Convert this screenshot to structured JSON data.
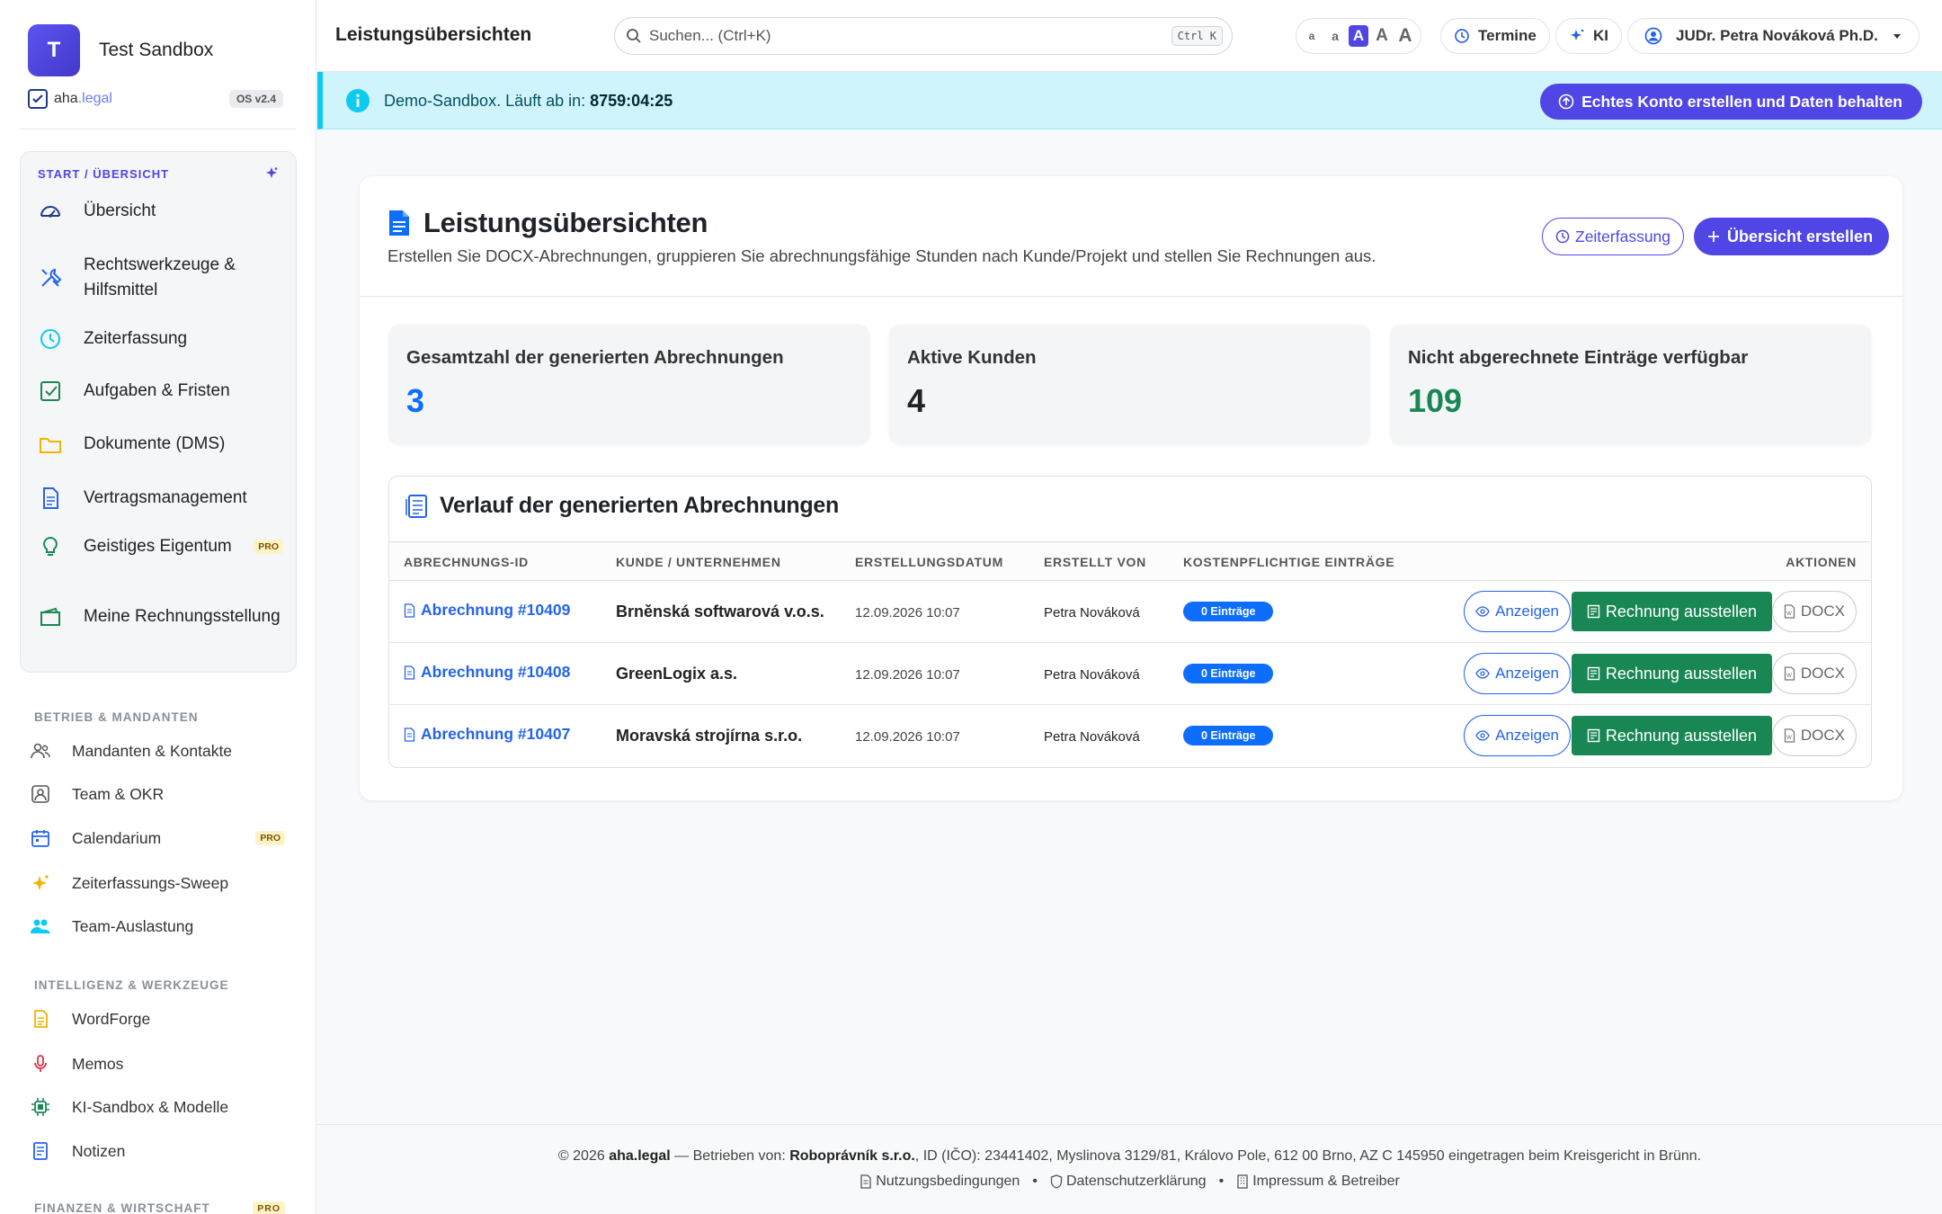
{
  "sidebar": {
    "avatar_letter": "T",
    "workspace_name": "Test Sandbox",
    "logo_brand": "aha",
    "logo_domain": ".legal",
    "os_version": "OS v2.4",
    "start_title": "START / ÜBERSICHT",
    "start_items": [
      {
        "label": "Übersicht",
        "icon": "gauge-icon"
      },
      {
        "label": "Rechtswerkzeuge & Hilfsmittel",
        "icon": "tools-icon"
      },
      {
        "label": "Zeiterfassung",
        "icon": "clock-icon"
      },
      {
        "label": "Aufgaben & Fristen",
        "icon": "check-square-icon"
      },
      {
        "label": "Dokumente (DMS)",
        "icon": "folder-icon"
      },
      {
        "label": "Vertragsmanagement",
        "icon": "document-icon"
      },
      {
        "label": "Geistiges Eigentum",
        "icon": "lightbulb-icon",
        "badge": "PRO"
      },
      {
        "label": "Meine Rechnungsstellung",
        "icon": "wallet-icon"
      }
    ],
    "section_betrieb": "BETRIEB & MANDANTEN",
    "betrieb_items": [
      {
        "label": "Mandanten & Kontakte",
        "icon": "people-icon"
      },
      {
        "label": "Team & OKR",
        "icon": "person-badge-icon"
      },
      {
        "label": "Calendarium",
        "icon": "calendar-icon",
        "badge": "PRO"
      },
      {
        "label": "Zeiterfassungs-Sweep",
        "icon": "sparkle-icon"
      },
      {
        "label": "Team-Auslastung",
        "icon": "team-icon"
      }
    ],
    "section_intelligenz": "INTELLIGENZ & WERKZEUGE",
    "intelligenz_items": [
      {
        "label": "WordForge",
        "icon": "file-word-icon"
      },
      {
        "label": "Memos",
        "icon": "microphone-icon"
      },
      {
        "label": "KI-Sandbox & Modelle",
        "icon": "cpu-icon"
      },
      {
        "label": "Notizen",
        "icon": "notes-icon"
      }
    ],
    "section_finanzen": "FINANZEN & WIRTSCHAFT",
    "finanzen_badge": "PRO"
  },
  "header": {
    "title": "Leistungsübersichten",
    "search_placeholder": "Suchen... (Ctrl+K)",
    "shortcut": "Ctrl K",
    "font_sizes": [
      "a",
      "a",
      "A",
      "A",
      "A"
    ],
    "termine": "Termine",
    "ki": "KI",
    "user": "JUDr. Petra Nováková Ph.D."
  },
  "banner": {
    "text": "Demo-Sandbox. Läuft ab in: ",
    "countdown": "8759:04:25",
    "cta": "Echtes Konto erstellen und Daten behalten"
  },
  "page": {
    "title": "Leistungsübersichten",
    "subtitle": "Erstellen Sie DOCX-Abrechnungen, gruppieren Sie abrechnungsfähige Stunden nach Kunde/Projekt und stellen Sie Rechnungen aus.",
    "btn_time": "Zeiterfassung",
    "btn_create": "Übersicht erstellen"
  },
  "stats": [
    {
      "label": "Gesamtzahl der generierten Abrechnungen",
      "value": "3",
      "color": "#0d6efd"
    },
    {
      "label": "Aktive Kunden",
      "value": "4",
      "color": "#1f2328"
    },
    {
      "label": "Nicht abgerechnete Einträge verfügbar",
      "value": "109",
      "color": "#198754"
    }
  ],
  "table": {
    "title": "Verlauf der generierten Abrechnungen",
    "columns": [
      "ABRECHNUNGS-ID",
      "KUNDE / UNTERNEHMEN",
      "ERSTELLUNGSDATUM",
      "ERSTELLT VON",
      "KOSTENPFLICHTIGE EINTRÄGE",
      "AKTIONEN"
    ],
    "rows": [
      {
        "id": "Abrechnung #10409",
        "customer": "Brněnská softwarová v.o.s.",
        "date": "12.09.2026 10:07",
        "by": "Petra Nováková",
        "entries": "0 Einträge"
      },
      {
        "id": "Abrechnung #10408",
        "customer": "GreenLogix a.s.",
        "date": "12.09.2026 10:07",
        "by": "Petra Nováková",
        "entries": "0 Einträge"
      },
      {
        "id": "Abrechnung #10407",
        "customer": "Moravská strojírna s.r.o.",
        "date": "12.09.2026 10:07",
        "by": "Petra Nováková",
        "entries": "0 Einträge"
      }
    ],
    "action_view": "Anzeigen",
    "action_invoice": "Rechnung ausstellen",
    "action_docx": "DOCX"
  },
  "footer": {
    "copyright": "© 2026 ",
    "brand": "aha.legal",
    "operated": " — Betrieben von: ",
    "company": "Roboprávník s.r.o.",
    "details": ", ID (IČO): 23441402, Myslinova 3129/81, Královo Pole, 612 00 Brno, AZ C 145950 eingetragen beim Kreisgericht in Brünn.",
    "link_terms": "Nutzungsbedingungen",
    "link_privacy": "Datenschutzerklärung",
    "link_imprint": "Impressum & Betreiber"
  }
}
